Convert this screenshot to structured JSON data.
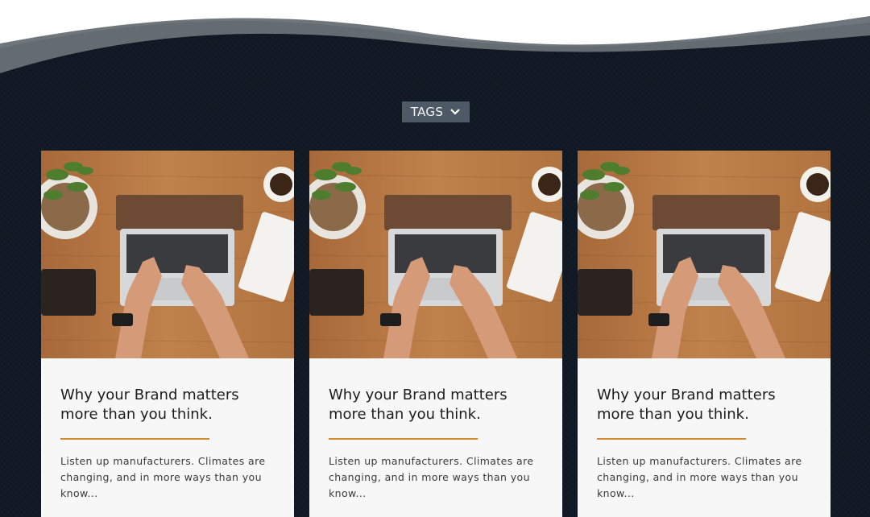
{
  "filter": {
    "label": "TAGS",
    "icon": "chevron-down-icon"
  },
  "colors": {
    "background": "#0f1722",
    "accent": "#d88a2b",
    "tag_bg": "#4d5965"
  },
  "cards": [
    {
      "image": "laptop-desk-photo",
      "title": "Why your Brand matters more than you think.",
      "excerpt": "Listen up manufacturers. Climates are changing, and in more ways than you know..."
    },
    {
      "image": "laptop-desk-photo",
      "title": "Why your Brand matters more than you think.",
      "excerpt": "Listen up manufacturers. Climates are changing, and in more ways than you know..."
    },
    {
      "image": "laptop-desk-photo",
      "title": "Why your Brand matters more than you think.",
      "excerpt": "Listen up manufacturers. Climates are changing, and in more ways than you know..."
    }
  ]
}
